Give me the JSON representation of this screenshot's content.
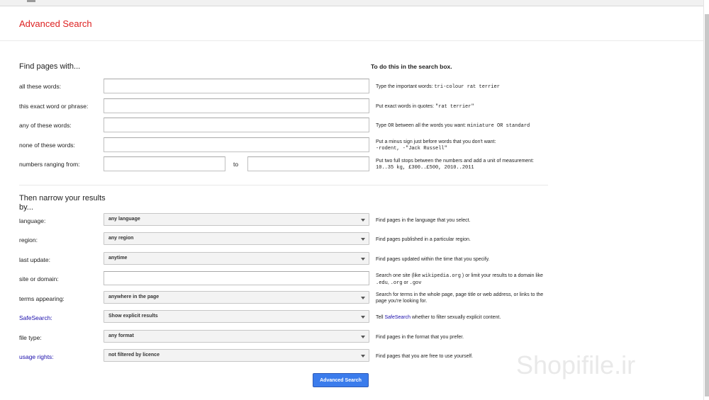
{
  "page_title": "Advanced Search",
  "find_section": {
    "heading": "Find pages with...",
    "column_heading": "To do this in the search box."
  },
  "fields": {
    "all_words": {
      "label": "all these words:",
      "hint_pre": "Type the important words: ",
      "hint_code": "tri-colour rat terrier"
    },
    "exact_phrase": {
      "label": "this exact word or phrase:",
      "hint_pre": "Put exact words in quotes: ",
      "hint_code": "\"rat terrier\""
    },
    "any_words": {
      "label": "any of these words:",
      "hint_pre": "Type ",
      "hint_code1": "OR",
      "hint_mid": " between all the words you want: ",
      "hint_code2": "miniature OR standard"
    },
    "none_words": {
      "label": "none of these words:",
      "hint_line1": "Put a minus sign just before words that you don't want:",
      "hint_code": "-rodent, -\"Jack Russell\""
    },
    "numbers": {
      "label": "numbers ranging from:",
      "to_label": "to",
      "hint_line1": "Put two full stops between the numbers and add a unit of measurement:",
      "hint_code": "10..35 kg, £300..£500, 2010..2011"
    }
  },
  "narrow_section": {
    "heading_line1": "Then narrow your results",
    "heading_line2": "by..."
  },
  "filters": {
    "language": {
      "label": "language:",
      "value": "any language",
      "hint": "Find pages in the language that you select."
    },
    "region": {
      "label": "region:",
      "value": "any region",
      "hint": "Find pages published in a particular region."
    },
    "last_update": {
      "label": "last update:",
      "value": "anytime",
      "hint": "Find pages updated within the time that you specify."
    },
    "site": {
      "label": "site or domain:",
      "hint_pre": "Search one site (like ",
      "hint_code1": "wikipedia.org",
      "hint_mid": " ) or limit your results to a domain like ",
      "hint_code2": ".edu",
      "hint_sep1": ", ",
      "hint_code3": ".org",
      "hint_sep2": " or ",
      "hint_code4": ".gov"
    },
    "terms": {
      "label": "terms appearing:",
      "value": "anywhere in the page",
      "hint": "Search for terms in the whole page, page title or web address, or links to the page you're looking for."
    },
    "safesearch": {
      "label": "SafeSearch:",
      "value": "Show explicit results",
      "hint_pre": "Tell ",
      "hint_link": "SafeSearch",
      "hint_post": " whether to filter sexually explicit content."
    },
    "file_type": {
      "label": "file type:",
      "value": "any format",
      "hint": "Find pages in the format that you prefer."
    },
    "usage_rights": {
      "label": "usage rights:",
      "value": "not filtered by licence",
      "hint": "Find pages that you are free to use yourself."
    }
  },
  "submit_label": "Advanced Search",
  "watermark": "Shopifile.ir",
  "colors": {
    "title": "#dd2222",
    "link": "#1a0dab",
    "button": "#3b7cec"
  }
}
